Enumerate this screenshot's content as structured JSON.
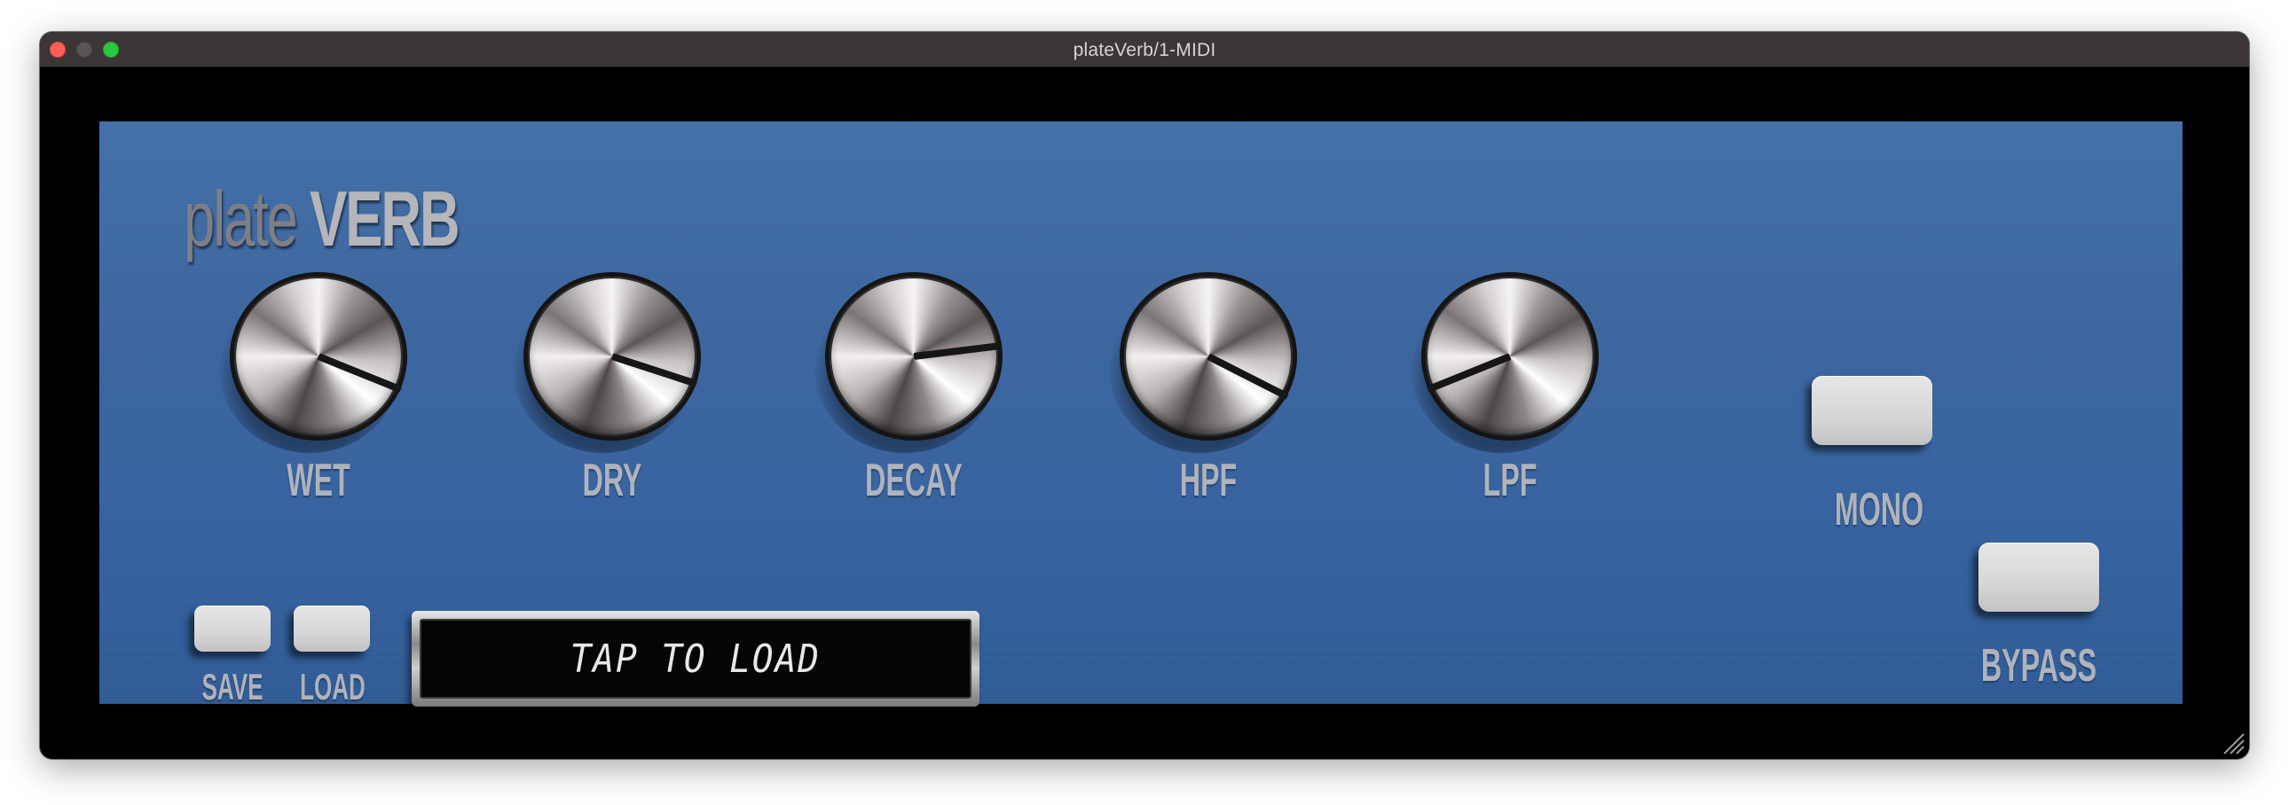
{
  "window": {
    "title": "plateVerb/1-MIDI",
    "traffic_lights": [
      "close",
      "minimize",
      "maximize"
    ]
  },
  "plugin": {
    "logo_word_1": "plate",
    "logo_word_2": "VERB",
    "knobs": [
      {
        "id": "wet",
        "label": "WET"
      },
      {
        "id": "dry",
        "label": "DRY"
      },
      {
        "id": "decay",
        "label": "DECAY"
      },
      {
        "id": "hpf",
        "label": "HPF"
      },
      {
        "id": "lpf",
        "label": "LPF"
      }
    ],
    "mono_label": "MONO",
    "bypass_label": "BYPASS",
    "save_label": "SAVE",
    "load_label": "LOAD",
    "display_text": "TAP TO LOAD"
  },
  "colors": {
    "panel_blue": "#3c66a0",
    "label_gray": "#aeb3bc",
    "window_bg": "#000000",
    "titlebar": "#3d3636"
  }
}
